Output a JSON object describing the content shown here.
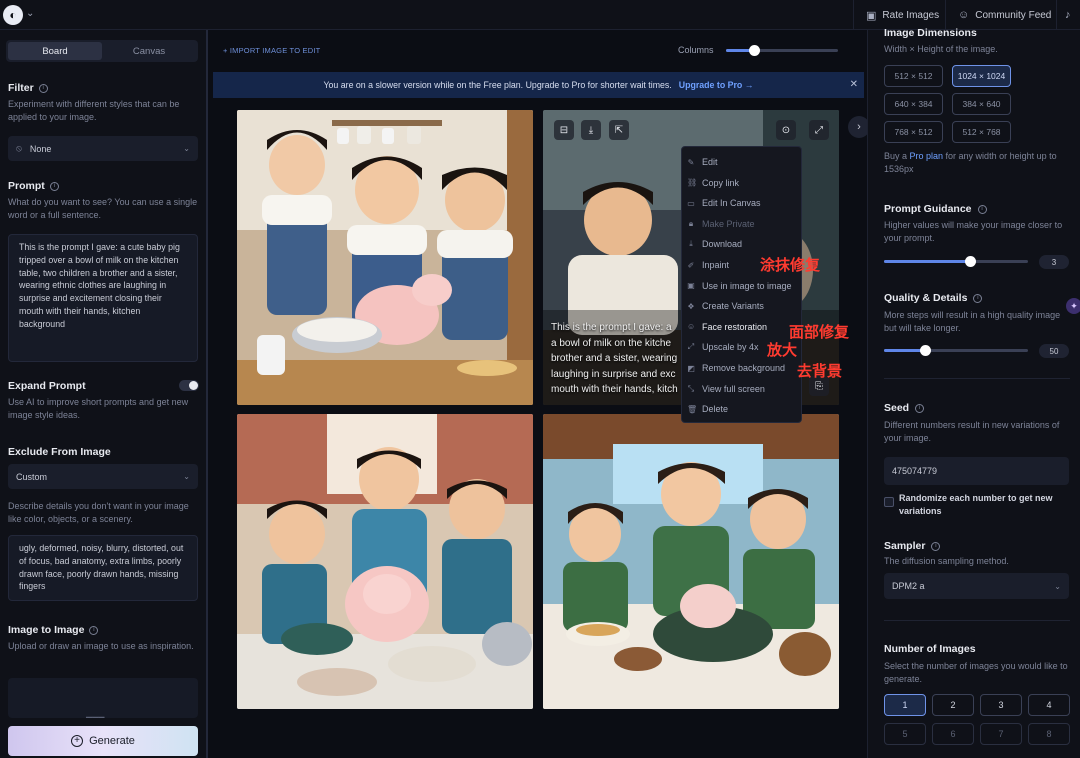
{
  "topbar": {
    "rate_images": "Rate Images",
    "community_feed": "Community Feed"
  },
  "left": {
    "tabs": [
      "Board",
      "Canvas"
    ],
    "filter": {
      "title": "Filter",
      "desc": "Experiment with different styles that can be applied to your image.",
      "value": "None"
    },
    "prompt": {
      "title": "Prompt",
      "desc": "What do you want to see? You can use a single word or a full sentence.",
      "value": "This is the prompt I gave: a cute baby pig tripped over a bowl of milk on the kitchen table, two children a brother and a sister, wearing ethnic clothes are laughing in surprise and excitement closing their mouth with their hands, kitchen background"
    },
    "expand_prompt": {
      "title": "Expand Prompt",
      "desc": "Use AI to improve short prompts and get new image style ideas."
    },
    "exclude": {
      "title": "Exclude From Image",
      "select": "Custom",
      "desc": "Describe details you don't want in your image like color, objects, or a scenery.",
      "value": "ugly, deformed, noisy, blurry, distorted, out of focus, bad anatomy, extra limbs, poorly drawn face, poorly drawn hands, missing fingers"
    },
    "image_to_image": {
      "title": "Image to Image",
      "desc": "Upload or draw an image to use as inspiration."
    },
    "generate": "Generate"
  },
  "center": {
    "import_link": "+ IMPORT IMAGE TO EDIT",
    "columns_label": "Columns",
    "banner_text": "You are on a slower version while on the Free plan. Upgrade to Pro for shorter wait times.",
    "banner_link": "Upgrade to Pro →",
    "overlay_text": "This is the prompt I gave: a cute baby pig tripped over a bowl of milk on the kitchen table, two children a brother and a sister, wearing ethnic clothes are laughing in surprise and excitement closing their mouth with their hands, kitchen background",
    "overlay_lines": [
      "This is the prompt I gave: a",
      "a bowl of milk on the kitche",
      "brother and a sister, wearing",
      "laughing in surprise and exc",
      "mouth with their hands, kitch"
    ],
    "menu": [
      {
        "label": "Edit",
        "icon": "pencil-icon",
        "state": "normal"
      },
      {
        "label": "Copy link",
        "icon": "link-icon",
        "state": "normal"
      },
      {
        "label": "Edit In Canvas",
        "icon": "canvas-icon",
        "state": "normal"
      },
      {
        "label": "Make Private",
        "icon": "lock-icon",
        "state": "dim"
      },
      {
        "label": "Download",
        "icon": "download-icon",
        "state": "normal"
      },
      {
        "label": "Inpaint",
        "icon": "brush-icon",
        "state": "normal"
      },
      {
        "label": "Use in image to image",
        "icon": "image-icon",
        "state": "normal"
      },
      {
        "label": "Create Variants",
        "icon": "variants-icon",
        "state": "normal"
      },
      {
        "label": "Face restoration",
        "icon": "face-icon",
        "state": "bright"
      },
      {
        "label": "Upscale by 4x",
        "icon": "upscale-icon",
        "state": "normal"
      },
      {
        "label": "Remove background",
        "icon": "remove-bg-icon",
        "state": "normal"
      },
      {
        "label": "View full screen",
        "icon": "fullscreen-icon",
        "state": "normal"
      },
      {
        "label": "Delete",
        "icon": "trash-icon",
        "state": "normal"
      }
    ],
    "annotations": {
      "inpaint": "涂抹修复",
      "face": "面部修复",
      "upscale": "放大",
      "remove_bg": "去背景"
    }
  },
  "right": {
    "dimensions": {
      "title": "Image Dimensions",
      "desc": "Width × Height of the image.",
      "options": [
        "512 × 512",
        "1024 × 1024",
        "640 × 384",
        "384 × 640",
        "768 × 512",
        "512 × 768"
      ],
      "selected": "1024 × 1024",
      "note_pre": "Buy a ",
      "note_link": "Pro plan",
      "note_post": " for any width or height up to 1536px"
    },
    "guidance": {
      "title": "Prompt Guidance",
      "desc": "Higher values will make your image closer to your prompt.",
      "value": "3"
    },
    "quality": {
      "title": "Quality & Details",
      "desc": "More steps will result in a high quality image but will take longer.",
      "value": "50"
    },
    "seed": {
      "title": "Seed",
      "desc": "Different numbers result in new variations of your image.",
      "value": "475074779",
      "randomize": "Randomize each number to get new variations"
    },
    "sampler": {
      "title": "Sampler",
      "desc": "The diffusion sampling method.",
      "value": "DPM2 a"
    },
    "num_images": {
      "title": "Number of Images",
      "desc": "Select the number of images you would like to generate.",
      "options": [
        "1",
        "2",
        "3",
        "4",
        "5",
        "6",
        "7",
        "8"
      ],
      "selected": "1"
    }
  }
}
